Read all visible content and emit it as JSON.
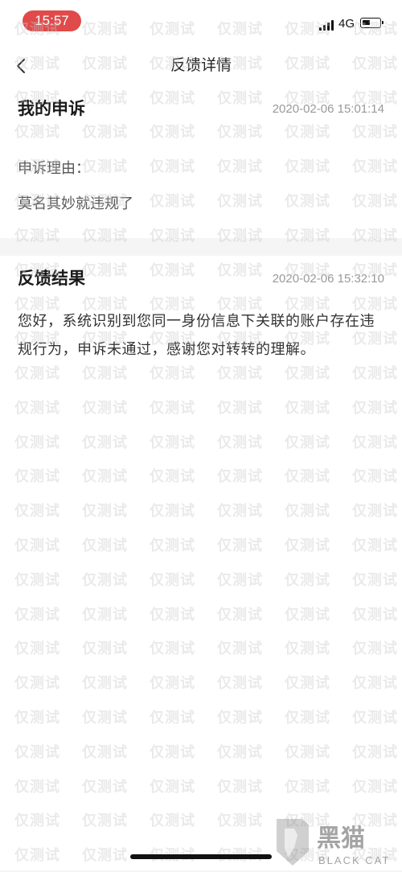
{
  "status_bar": {
    "time": "15:57",
    "network": "4G"
  },
  "nav": {
    "title": "反馈详情",
    "back_icon": "chevron-left-icon"
  },
  "appeal": {
    "title": "我的申诉",
    "time": "2020-02-06 15:01:14",
    "reason_label": "申诉理由：",
    "reason_text": "莫名其妙就违规了"
  },
  "result": {
    "title": "反馈结果",
    "time": "2020-02-06 15:32:10",
    "text": "您好，系统识别到您同一身份信息下关联的账户存在违规行为，申诉未通过，感谢您对转转的理解。"
  },
  "watermark": {
    "text": "仅测试"
  },
  "brand": {
    "name": "黑猫",
    "tagline": "BLACK CAT"
  },
  "colors": {
    "time_pill": "#e04a4a",
    "page_background": "#f5f5f5",
    "card_background": "#ffffff",
    "timestamp": "#999999"
  }
}
